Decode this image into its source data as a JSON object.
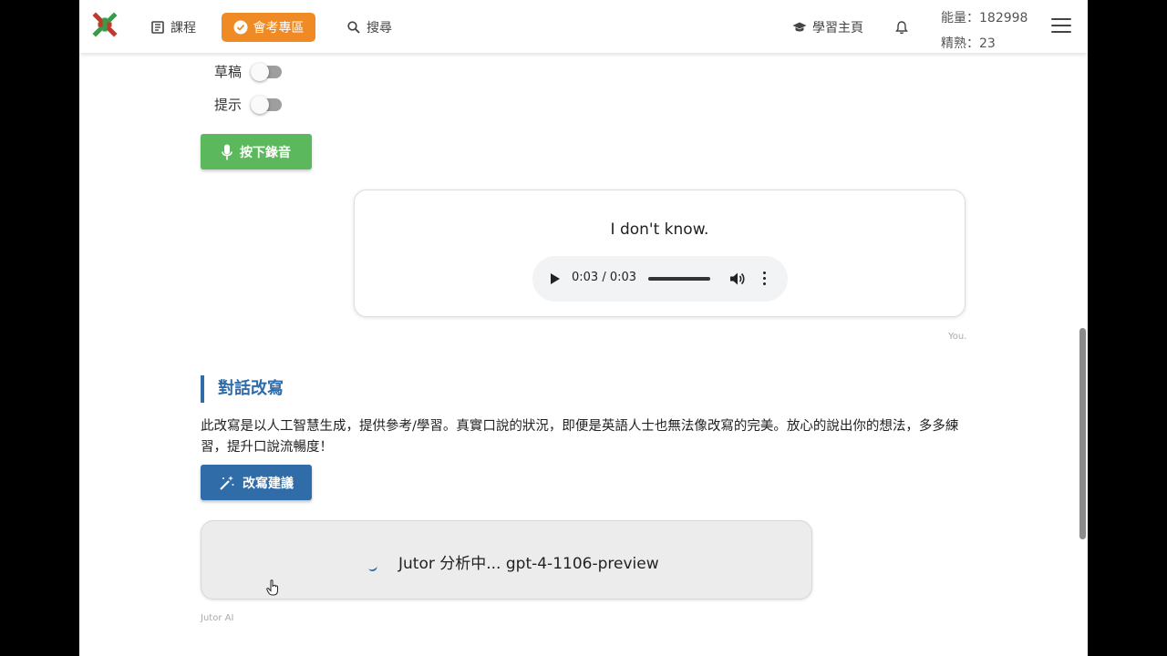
{
  "nav": {
    "courses": "課程",
    "exam_zone": "會考專區",
    "search": "搜尋",
    "learning_home": "學習主頁",
    "energy": "能量：182998",
    "mastery": "精熟：23"
  },
  "toggles": [
    {
      "label": "草稿",
      "on": false
    },
    {
      "label": "提示",
      "on": false
    }
  ],
  "record_button": "按下錄音",
  "speech": {
    "text": "I don't know.",
    "audio_time": "0:03 / 0:03",
    "caption": "You."
  },
  "rewrite_section": {
    "title": "對話改寫",
    "description": "此改寫是以人工智慧生成，提供參考/學習。真實口說的狀況，即便是英語人士也無法像改寫的完美。放心的說出你的想法，多多練習，提升口說流暢度！",
    "button": "改寫建議"
  },
  "ai": {
    "status": "Jutor 分析中... gpt-4-1106-preview",
    "caption": "Jutor AI"
  },
  "colors": {
    "accent_orange": "#f08a24",
    "record_green": "#5cb85c",
    "primary_blue": "#2f6ca8"
  }
}
